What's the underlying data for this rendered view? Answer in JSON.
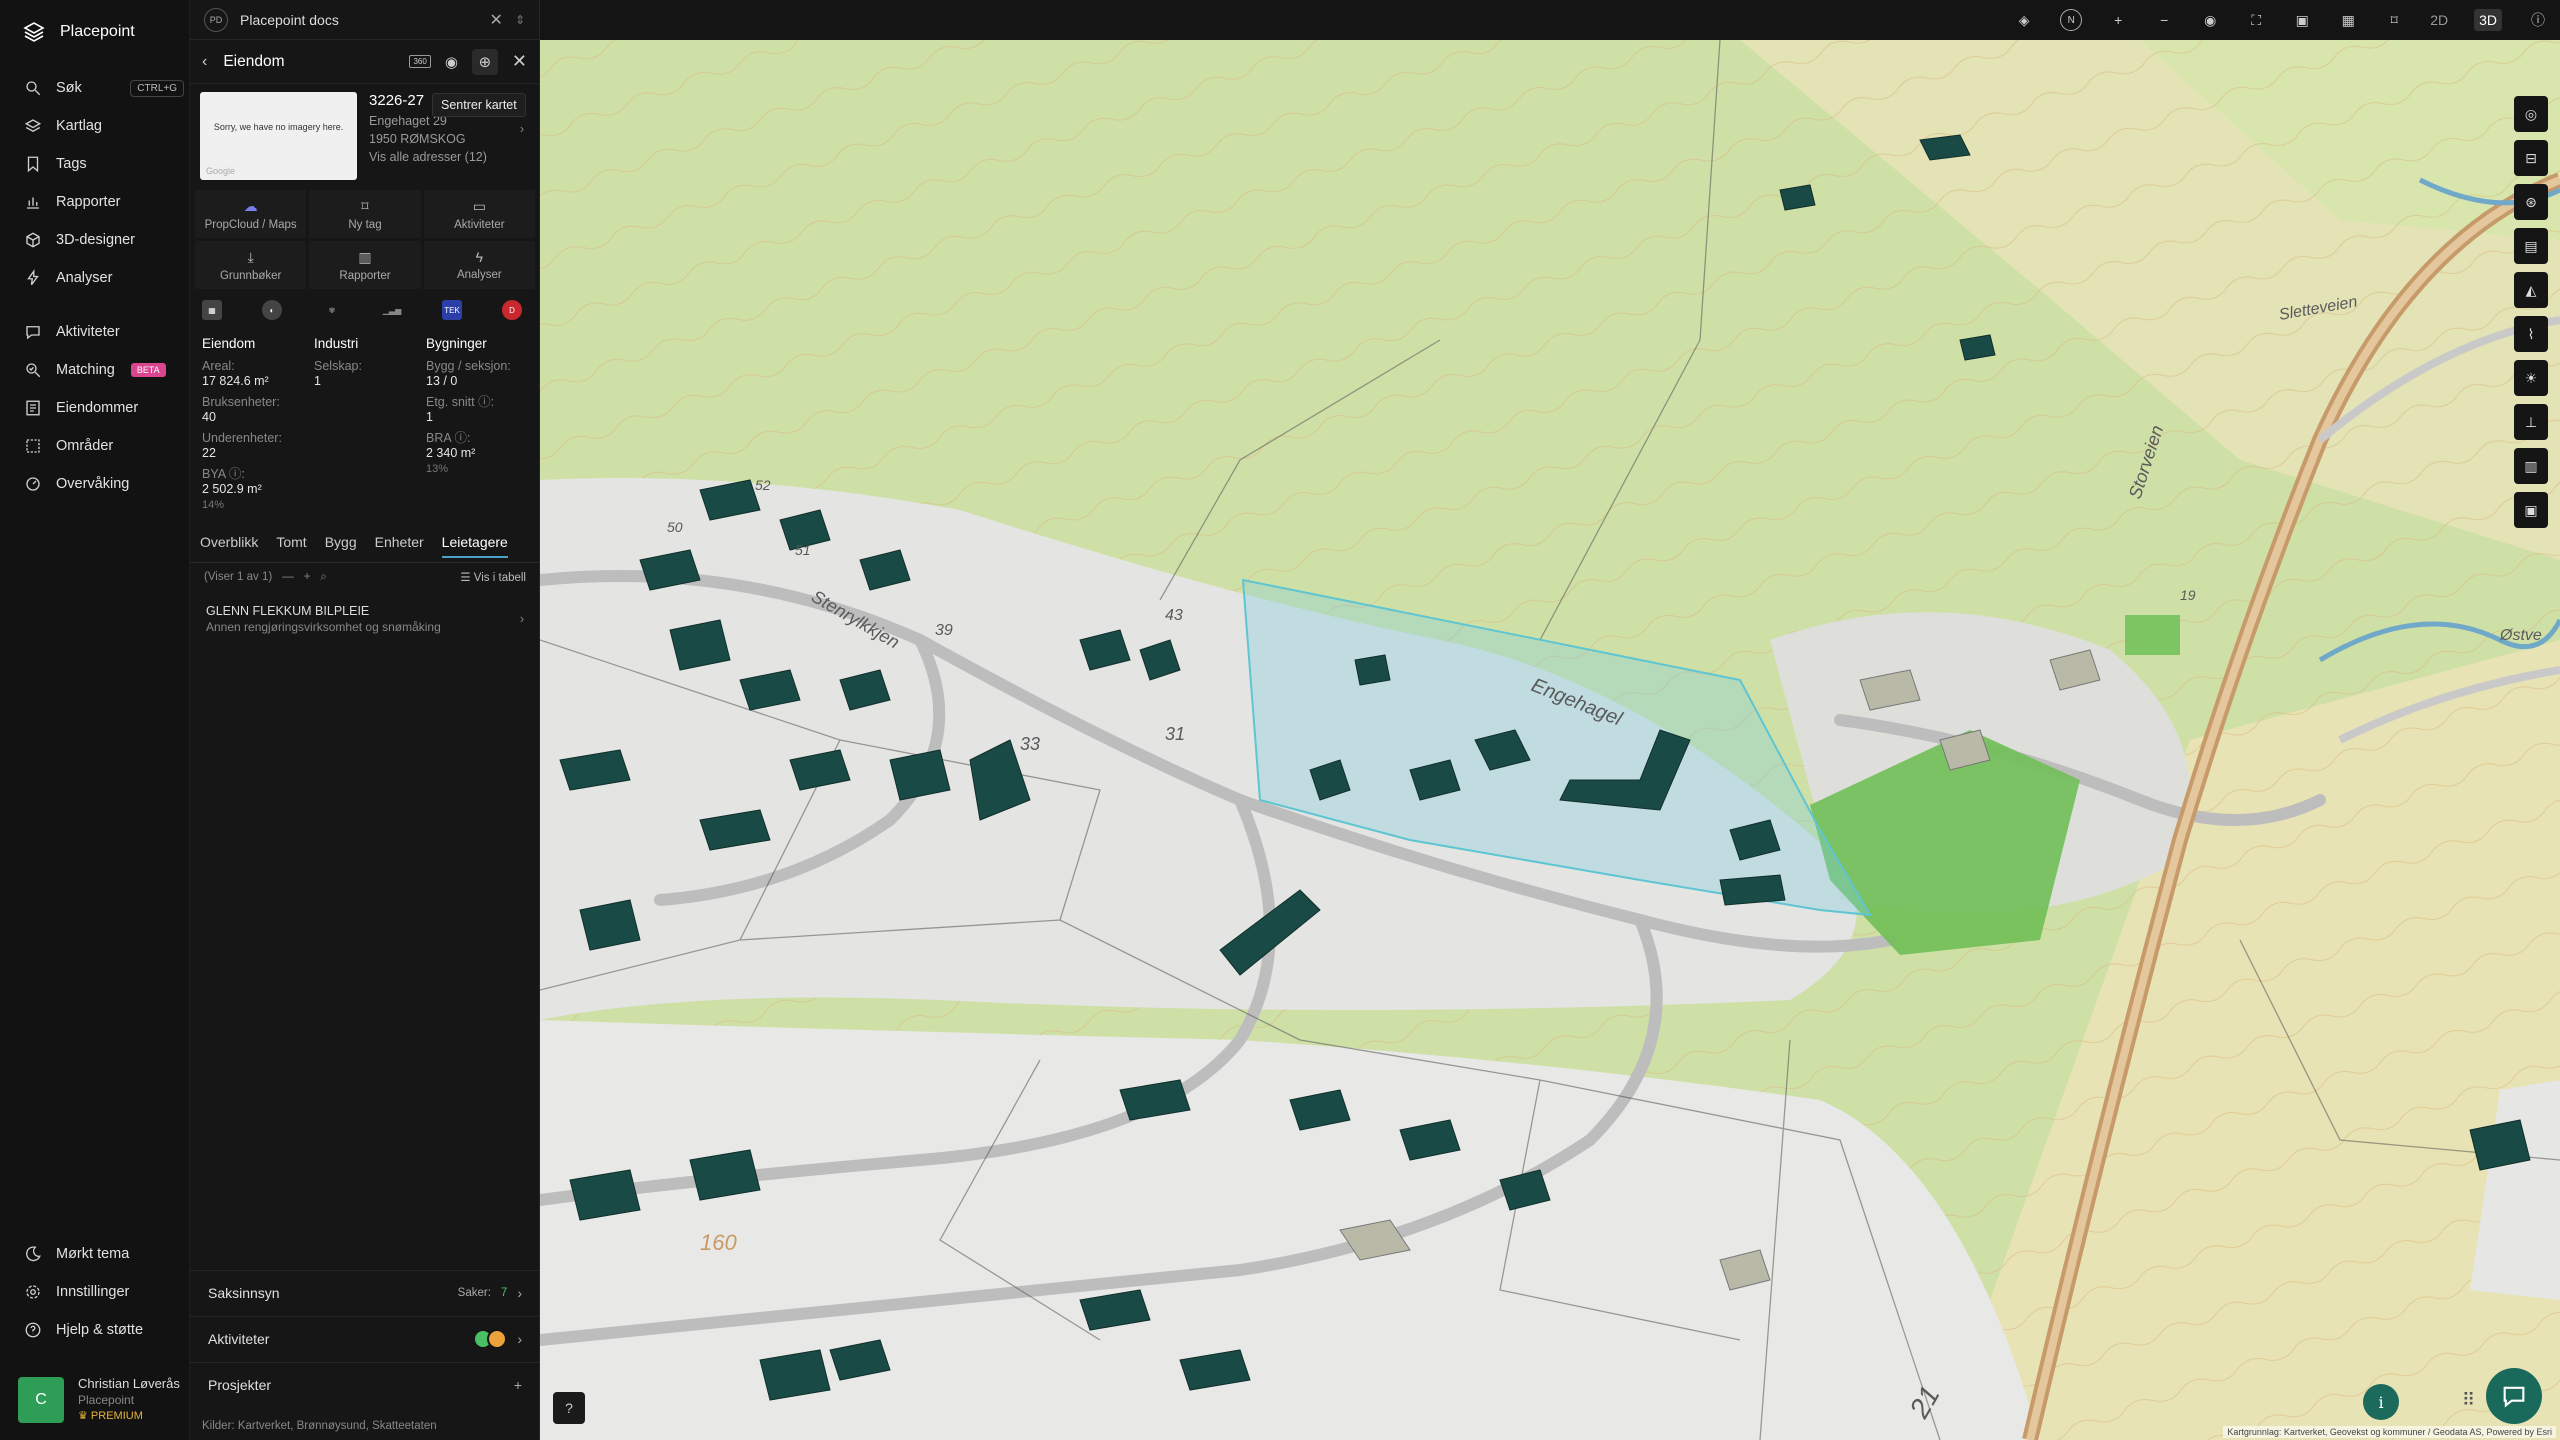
{
  "app": {
    "name": "Placepoint"
  },
  "nav": {
    "items": [
      {
        "label": "Søk",
        "shortcut": "CTRL+G"
      },
      {
        "label": "Kartlag"
      },
      {
        "label": "Tags"
      },
      {
        "label": "Rapporter"
      },
      {
        "label": "3D-designer"
      },
      {
        "label": "Analyser"
      },
      {
        "label": "Aktiviteter"
      },
      {
        "label": "Matching",
        "badge": "BETA"
      },
      {
        "label": "Eiendommer"
      },
      {
        "label": "Områder"
      },
      {
        "label": "Overvåking"
      }
    ],
    "bottom": [
      {
        "label": "Mørkt tema"
      },
      {
        "label": "Innstillinger"
      },
      {
        "label": "Hjelp & støtte"
      }
    ],
    "user": {
      "initial": "C",
      "name": "Christian Løverås",
      "org": "Placepoint",
      "plan": "PREMIUM"
    }
  },
  "tab": {
    "badge": "PD",
    "title": "Placepoint docs"
  },
  "panel": {
    "title": "Eiendom",
    "badge_360": "360",
    "tooltip": "Sentrer kartet",
    "image_note": "Sorry, we have no imagery here.",
    "image_credit": "Google",
    "gnr": "3226-27",
    "address": "Engehaget 29",
    "postal": "1950 RØMSKOG",
    "all_addresses": "Vis alle adresser (12)",
    "actions": [
      {
        "label": "PropCloud / Maps"
      },
      {
        "label": "Ny tag"
      },
      {
        "label": "Aktiviteter"
      },
      {
        "label": "Grunnbøker"
      },
      {
        "label": "Rapporter"
      },
      {
        "label": "Analyser"
      }
    ],
    "source_tek": "TEK",
    "source_d": "D",
    "stats": {
      "eiendom": {
        "heading": "Eiendom",
        "areal_label": "Areal:",
        "areal": "17 824.6 m²",
        "bruk_label": "Bruksenheter:",
        "bruk": "40",
        "under_label": "Underenheter:",
        "under": "22",
        "bya_label": "BYA ⓘ:",
        "bya": "2 502.9 m²",
        "bya_pct": "14%"
      },
      "industri": {
        "heading": "Industri",
        "selskap_label": "Selskap:",
        "selskap": "1"
      },
      "bygninger": {
        "heading": "Bygninger",
        "bygg_label": "Bygg / seksjon:",
        "bygg": "13 / 0",
        "etg_label": "Etg. snitt ⓘ:",
        "etg": "1",
        "bra_label": "BRA ⓘ:",
        "bra": "2 340 m²",
        "bra_pct": "13%"
      }
    },
    "subtabs": [
      "Overblikk",
      "Tomt",
      "Bygg",
      "Enheter",
      "Leietagere"
    ],
    "list_info": "(Viser 1 av 1)",
    "vis_tabell": "Vis i tabell",
    "company": {
      "name": "GLENN FLEKKUM BILPLEIE",
      "desc": "Annen rengjøringsvirksomhet og snømåking"
    },
    "saksinnsyn": {
      "label": "Saksinnsyn",
      "cases_label": "Saker:",
      "cases": "7"
    },
    "aktiviteter_label": "Aktiviteter",
    "prosjekter_label": "Prosjekter",
    "kilder": {
      "label": "Kilder:",
      "items": [
        "Kartverket,",
        "Brønnøysund,",
        "Skatteetaten"
      ]
    }
  },
  "topbar": {
    "north": "N",
    "mode_2d": "2D",
    "mode_3d": "3D"
  },
  "map": {
    "labels": {
      "road": "Engehagel",
      "road2": "Storveien",
      "road3": "Sletteveien",
      "road4": "Stenrylkkjen",
      "road5": "Østve",
      "num_50": "50",
      "num_51": "51",
      "num_52": "52",
      "num_39": "39",
      "num_43": "43",
      "num_31": "31",
      "num_33": "33",
      "num_160": "160",
      "num_21": "21",
      "num_19": "19"
    },
    "attribution": "Kartgrunnlag: Kartverket, Geovekst og kommuner / Geodata AS, Powered by Esri",
    "colors": {
      "terrain": "#cfe0a7",
      "settlement": "#e6e6e6",
      "building": "#1a4a45",
      "selection": "#80cfe0",
      "field": "#6fbf57",
      "water": "#6fa8c8"
    }
  }
}
